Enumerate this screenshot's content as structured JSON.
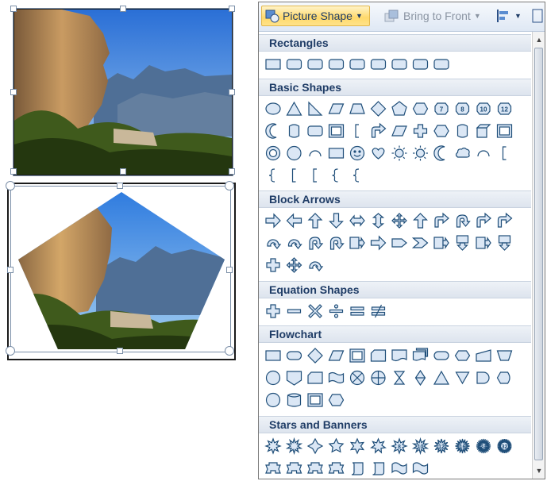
{
  "toolbar": {
    "picture_shape_label": "Picture Shape",
    "bring_to_front_label": "Bring to Front"
  },
  "categories": [
    {
      "name": "Rectangles",
      "count": 9
    },
    {
      "name": "Basic Shapes",
      "count": 42
    },
    {
      "name": "Block Arrows",
      "count": 27
    },
    {
      "name": "Equation Shapes",
      "count": 6
    },
    {
      "name": "Flowchart",
      "count": 28
    },
    {
      "name": "Stars and Banners",
      "count": 20
    }
  ],
  "star_labels": [
    "8",
    "10",
    "12",
    "16",
    "24",
    "32"
  ],
  "number_badges": [
    "7",
    "8",
    "10",
    "12"
  ],
  "colors": {
    "ribbon_accent": "#ffd96b",
    "header_text": "#1f3c66",
    "shape_stroke": "#1f4e79",
    "shape_fill": "#dbe7f5"
  }
}
